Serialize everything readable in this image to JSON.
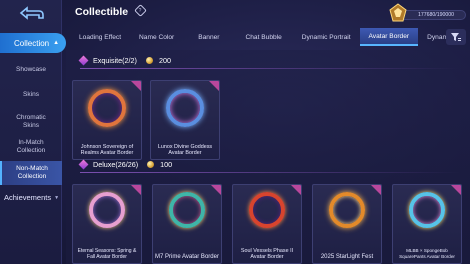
{
  "header": {
    "title": "Collectible",
    "currency_value": "177680/190000"
  },
  "sidebar": {
    "main_label": "Collection",
    "items": [
      {
        "label": "Showcase"
      },
      {
        "label": "Skins"
      },
      {
        "label": "Chromatic Skins"
      },
      {
        "label": "In-Match Collection"
      },
      {
        "label": "Non-Match Collection"
      }
    ],
    "achievements_label": "Achievements"
  },
  "tabs": [
    {
      "label": "Loading Effect"
    },
    {
      "label": "Name Color"
    },
    {
      "label": "Banner"
    },
    {
      "label": "Chat Bubble"
    },
    {
      "label": "Dynamic Portrait"
    },
    {
      "label": "Avatar Border"
    },
    {
      "label": "Dynami"
    }
  ],
  "sections": [
    {
      "title": "Exquisite(2/2)",
      "points": "200",
      "cards": [
        {
          "name": "Johnson Sovereign of Realms Avatar Border"
        },
        {
          "name": "Lunox Divine Goddess Avatar Border"
        }
      ]
    },
    {
      "title": "Deluxe(26/26)",
      "points": "100",
      "cards": [
        {
          "name": "Eternal Seasons: Spring & Fall Avatar Border"
        },
        {
          "name": "M7 Prime Avatar Border"
        },
        {
          "name": "Soul Vessels Phase II Avatar Border"
        },
        {
          "name": "2025 StarLight Fest"
        },
        {
          "name": "MLBB × SpongeBob SquarePants Avatar Border"
        }
      ]
    }
  ],
  "colors": {
    "accent": "#3aa0f0",
    "tab_active": "#3e59b3",
    "badge_pink": "#b9479c"
  }
}
